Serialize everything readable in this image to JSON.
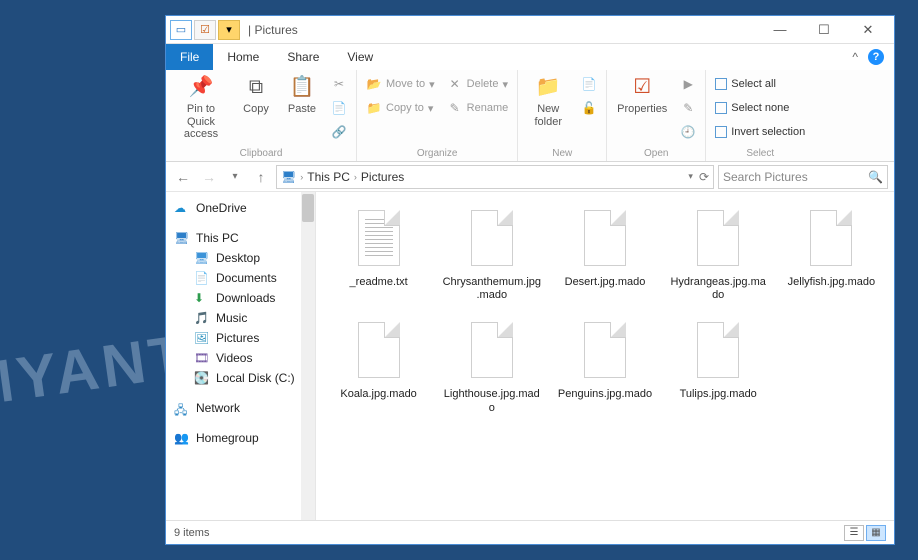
{
  "titlebar": {
    "title": "Pictures"
  },
  "wincontrols": {
    "min": "—",
    "max": "☐",
    "close": "✕"
  },
  "tabs": {
    "file": "File",
    "home": "Home",
    "share": "Share",
    "view": "View",
    "collapse": "^",
    "help": "?"
  },
  "ribbon": {
    "clipboard": {
      "label": "Clipboard",
      "pin": "Pin to Quick\naccess",
      "copy": "Copy",
      "paste": "Paste"
    },
    "organize": {
      "label": "Organize",
      "moveto": "Move to",
      "copyto": "Copy to",
      "delete": "Delete",
      "rename": "Rename"
    },
    "new": {
      "label": "New",
      "newfolder": "New\nfolder"
    },
    "open": {
      "label": "Open",
      "properties": "Properties"
    },
    "select": {
      "label": "Select",
      "selectall": "Select all",
      "selectnone": "Select none",
      "invert": "Invert selection"
    }
  },
  "breadcrumb": {
    "root": "This PC",
    "folder": "Pictures"
  },
  "search": {
    "placeholder": "Search Pictures"
  },
  "nav": {
    "onedrive": "OneDrive",
    "thispc": "This PC",
    "desktop": "Desktop",
    "documents": "Documents",
    "downloads": "Downloads",
    "music": "Music",
    "pictures": "Pictures",
    "videos": "Videos",
    "localdisk": "Local Disk (C:)",
    "network": "Network",
    "homegroup": "Homegroup"
  },
  "files": [
    {
      "name": "_readme.txt",
      "type": "text"
    },
    {
      "name": "Chrysanthemum.jpg.mado",
      "type": "blank"
    },
    {
      "name": "Desert.jpg.mado",
      "type": "blank"
    },
    {
      "name": "Hydrangeas.jpg.mado",
      "type": "blank"
    },
    {
      "name": "Jellyfish.jpg.mado",
      "type": "blank"
    },
    {
      "name": "Koala.jpg.mado",
      "type": "blank"
    },
    {
      "name": "Lighthouse.jpg.mado",
      "type": "blank"
    },
    {
      "name": "Penguins.jpg.mado",
      "type": "blank"
    },
    {
      "name": "Tulips.jpg.mado",
      "type": "blank"
    }
  ],
  "status": {
    "count": "9 items"
  },
  "watermark": "MYANTISPYWARE.COM"
}
